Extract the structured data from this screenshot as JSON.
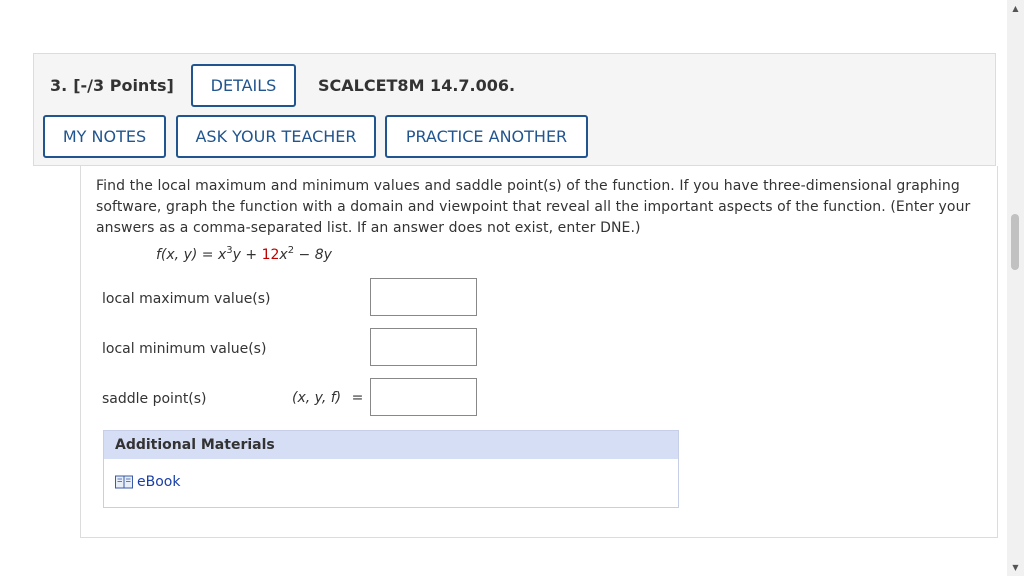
{
  "question": {
    "number": "3.",
    "points": "[-/3 Points]",
    "details_label": "DETAILS",
    "code": "SCALCET8M 14.7.006.",
    "buttons": {
      "my_notes": "MY NOTES",
      "ask_teacher": "ASK YOUR TEACHER",
      "practice_another": "PRACTICE ANOTHER"
    },
    "prompt": "Find the local maximum and minimum values and saddle point(s) of the function. If you have three-dimensional graphing software, graph the function with a domain and viewpoint that reveal all the important aspects of the function. (Enter your answers as a comma-separated list. If an answer does not exist, enter DNE.)",
    "formula": {
      "lhs": "f(x, y)",
      "equals": "=",
      "term1_base": "x",
      "term1_exp": "3",
      "term1_tail": "y",
      "plus": "+",
      "coef": "12",
      "term2_base": "x",
      "term2_exp": "2",
      "minus": "−",
      "term3": "8y"
    },
    "answers": [
      {
        "label": "local maximum value(s)",
        "value": ""
      },
      {
        "label": "local minimum value(s)",
        "value": ""
      },
      {
        "label": "saddle point(s)",
        "value": "",
        "prefix": "(x, y, f)",
        "equals": "="
      }
    ]
  },
  "materials": {
    "heading": "Additional Materials",
    "ebook_label": "eBook",
    "ebook_icon": "book-icon"
  },
  "colors": {
    "accent": "#21558f",
    "coef_red": "#c00000",
    "materials_header": "#d6def5",
    "link": "#1a3fa5"
  }
}
